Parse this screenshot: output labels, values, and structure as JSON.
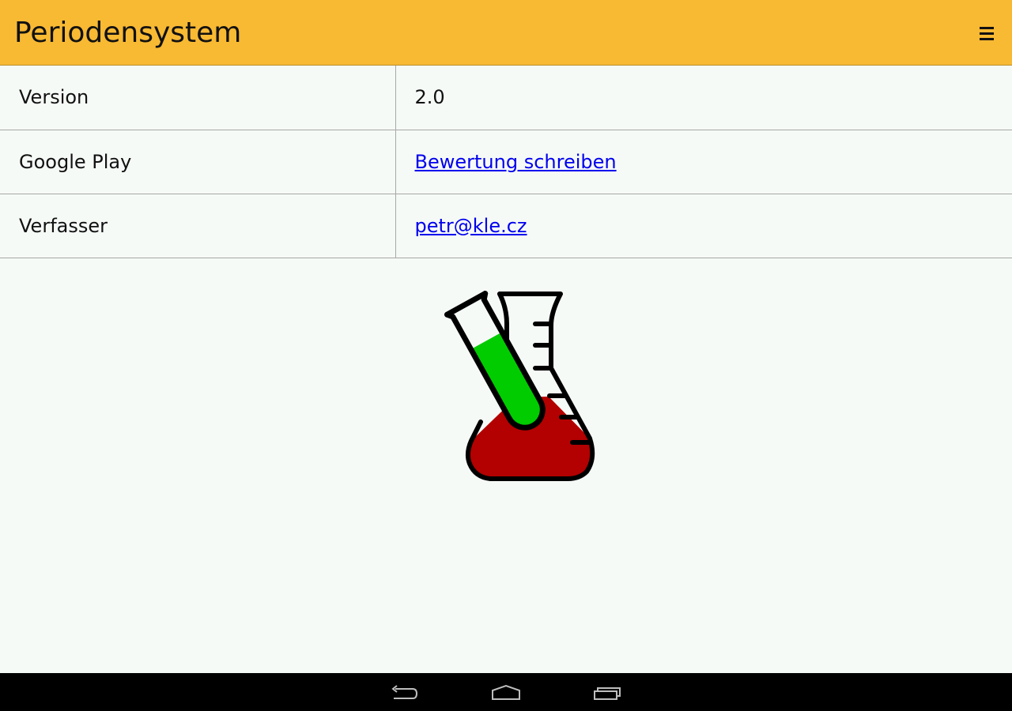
{
  "appbar": {
    "title": "Periodensystem",
    "menu_icon": "hamburger-menu-icon",
    "background_color": "#f8b933"
  },
  "info_rows": [
    {
      "label": "Version",
      "value": "2.0",
      "is_link": false
    },
    {
      "label": "Google Play",
      "value": "Bewertung schreiben",
      "is_link": true
    },
    {
      "label": "Verfasser",
      "value": "petr@kle.cz",
      "is_link": true
    }
  ],
  "logo": {
    "icon": "chemistry-flask-test-tube-icon",
    "tube_liquid_color": "#00cc00",
    "flask_liquid_color": "#b30000"
  },
  "navbar": {
    "buttons": [
      "back-icon",
      "home-icon",
      "recent-apps-icon"
    ]
  }
}
